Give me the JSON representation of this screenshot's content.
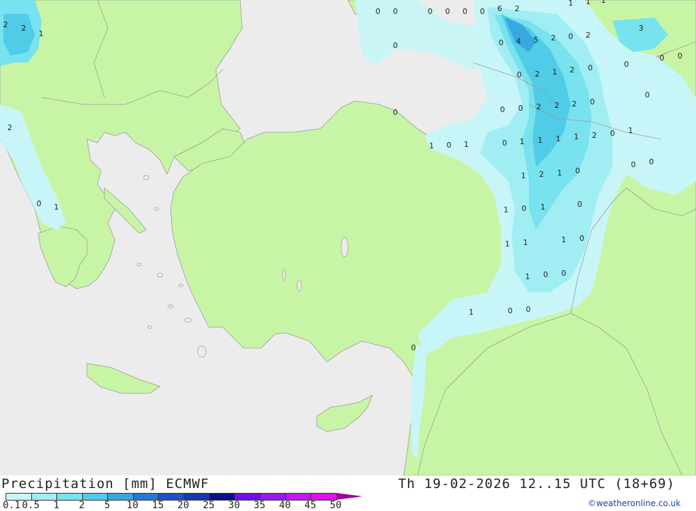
{
  "title": "Precipitation [mm] ECMWF",
  "datetime": "Th 19-02-2026 12..15 UTC (18+69)",
  "credit": "©weatheronline.co.uk",
  "colors": {
    "sea": "#ececec",
    "land": "#c8f5a5",
    "border": "#9a9a9a",
    "precip": [
      "#c8f6f8",
      "#a0eef4",
      "#78e2ee",
      "#50cce6",
      "#38a8e0",
      "#2878d8",
      "#2050c8",
      "#1838b0",
      "#0a108a",
      "#7010e8",
      "#9a18f0",
      "#c018f0",
      "#e010e8",
      "#c010b8",
      "#a00890"
    ]
  },
  "legend": {
    "labels": [
      "0.1",
      "0.5",
      "1",
      "2",
      "5",
      "10",
      "15",
      "20",
      "25",
      "30",
      "35",
      "40",
      "45",
      "50"
    ]
  },
  "map_values": [
    "0",
    "0",
    "0",
    "0",
    "0",
    "0",
    "6",
    "2",
    "1",
    "1",
    "1",
    "2",
    "2",
    "1",
    "0",
    "0",
    "3",
    "0",
    "0",
    "0",
    "4",
    "5",
    "2",
    "0",
    "2",
    "0",
    "0",
    "2",
    "1",
    "2",
    "0",
    "0",
    "0",
    "2",
    "2",
    "2",
    "0",
    "2",
    "0",
    "1",
    "0",
    "1",
    "0",
    "1",
    "1",
    "1",
    "1",
    "2",
    "0",
    "1",
    "0",
    "0",
    "1",
    "2",
    "1",
    "0",
    "0",
    "1",
    "1",
    "0",
    "1",
    "0",
    "1",
    "1",
    "1",
    "0",
    "1",
    "0",
    "0",
    "1",
    "0",
    "0",
    "0"
  ]
}
